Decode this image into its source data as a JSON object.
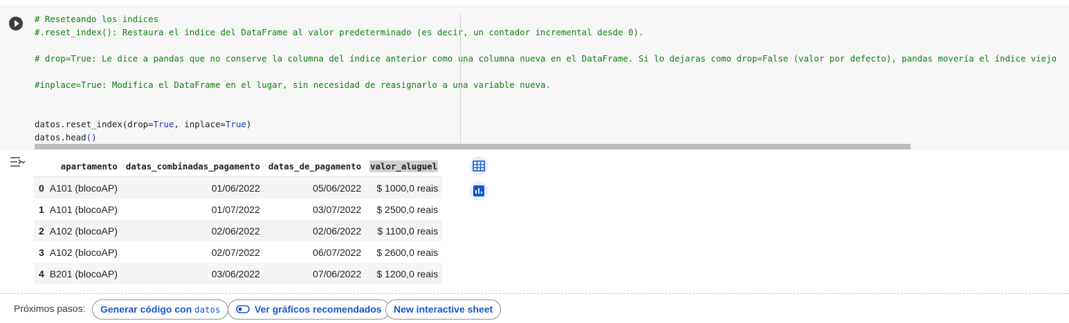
{
  "cell": {
    "code_lines": [
      {
        "segments": [
          {
            "t": "# Reseteando los indices",
            "c": "cmt"
          }
        ]
      },
      {
        "segments": [
          {
            "t": "#.reset_index(): Restaura el índice del DataFrame al valor predeterminado (es decir, un contador incremental desde 0).",
            "c": "cmt"
          }
        ]
      },
      {
        "segments": []
      },
      {
        "segments": [
          {
            "t": "# drop=True: Le dice a pandas que no conserve la columna del índice anterior como una columna nueva en el DataFrame. Si lo dejaras como drop=False (valor por defecto), pandas movería el índice viejo",
            "c": "cmt"
          }
        ]
      },
      {
        "segments": []
      },
      {
        "segments": [
          {
            "t": "#inplace=True: Modifica el DataFrame en el lugar, sin necesidad de reasignarlo a una variable nueva.",
            "c": "cmt"
          }
        ]
      },
      {
        "segments": []
      },
      {
        "segments": []
      },
      {
        "segments": [
          {
            "t": "datos.reset_index(drop=",
            "c": ""
          },
          {
            "t": "True",
            "c": "kw"
          },
          {
            "t": ", inplace=",
            "c": ""
          },
          {
            "t": "True",
            "c": "kw"
          },
          {
            "t": ")",
            "c": ""
          }
        ]
      },
      {
        "segments": [
          {
            "t": "datos.head",
            "c": ""
          },
          {
            "t": "()",
            "c": "kw"
          }
        ]
      }
    ]
  },
  "table": {
    "columns": [
      "apartamento",
      "datas_combinadas_pagamento",
      "datas_de_pagamento",
      "valor_aluguel"
    ],
    "highlighted_column": "valor_aluguel",
    "rows": [
      {
        "index": "0",
        "apartamento": "A101 (blocoAP)",
        "datas_combinadas_pagamento": "01/06/2022",
        "datas_de_pagamento": "05/06/2022",
        "valor_aluguel": "$ 1000,0 reais"
      },
      {
        "index": "1",
        "apartamento": "A101 (blocoAP)",
        "datas_combinadas_pagamento": "01/07/2022",
        "datas_de_pagamento": "03/07/2022",
        "valor_aluguel": "$ 2500,0 reais"
      },
      {
        "index": "2",
        "apartamento": "A102 (blocoAP)",
        "datas_combinadas_pagamento": "02/06/2022",
        "datas_de_pagamento": "02/06/2022",
        "valor_aluguel": "$ 1100,0 reais"
      },
      {
        "index": "3",
        "apartamento": "A102 (blocoAP)",
        "datas_combinadas_pagamento": "02/07/2022",
        "datas_de_pagamento": "06/07/2022",
        "valor_aluguel": "$ 2600,0 reais"
      },
      {
        "index": "4",
        "apartamento": "B201 (blocoAP)",
        "datas_combinadas_pagamento": "03/06/2022",
        "datas_de_pagamento": "07/06/2022",
        "valor_aluguel": "$ 1200,0 reais"
      }
    ]
  },
  "next_steps": {
    "label": "Próximos pasos:",
    "generate_prefix": "Generar código con",
    "generate_var": "datos",
    "charts_label": "Ver gráficos recomendados",
    "sheet_label": "New interactive sheet"
  },
  "colors": {
    "accent": "#1a56c8",
    "comment": "#108010",
    "keyword": "#1a36c8"
  },
  "icons": [
    "run-cell-icon",
    "output-options-icon",
    "table-view-icon",
    "chart-suggest-icon",
    "toggle-icon"
  ]
}
